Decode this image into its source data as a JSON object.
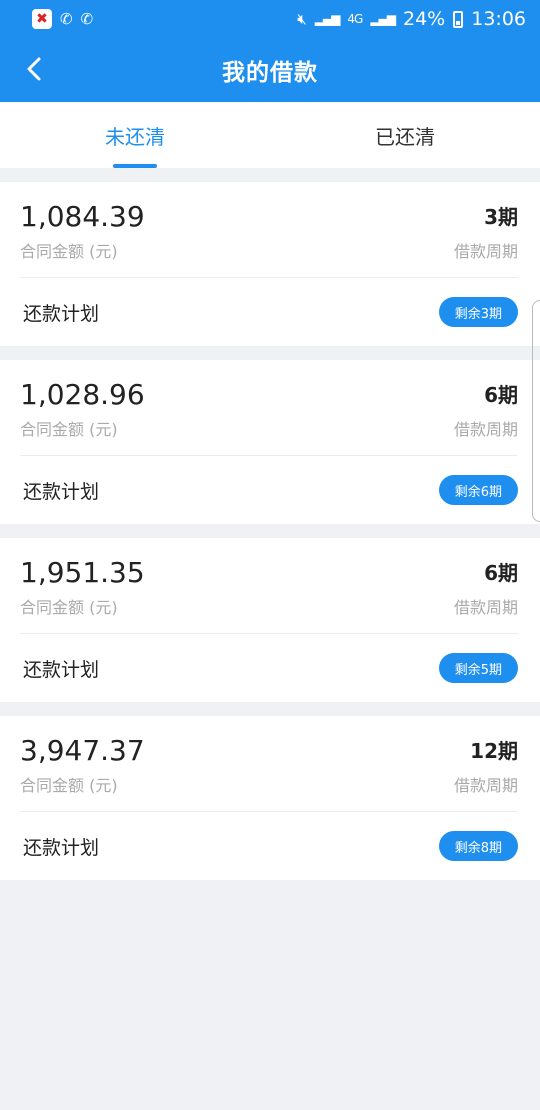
{
  "statusbar": {
    "network": "4G",
    "battery": "24%",
    "time": "13:06"
  },
  "header": {
    "title": "我的借款"
  },
  "tabs": [
    {
      "label": "未还清",
      "active": true
    },
    {
      "label": "已还清",
      "active": false
    }
  ],
  "loans": [
    {
      "amount": "1,084.39",
      "amount_label": "合同金额 (元)",
      "period": "3期",
      "period_label": "借款周期",
      "plan_label": "还款计划",
      "remaining": "剩余3期"
    },
    {
      "amount": "1,028.96",
      "amount_label": "合同金额 (元)",
      "period": "6期",
      "period_label": "借款周期",
      "plan_label": "还款计划",
      "remaining": "剩余6期"
    },
    {
      "amount": "1,951.35",
      "amount_label": "合同金额 (元)",
      "period": "6期",
      "period_label": "借款周期",
      "plan_label": "还款计划",
      "remaining": "剩余5期"
    },
    {
      "amount": "3,947.37",
      "amount_label": "合同金额 (元)",
      "period": "12期",
      "period_label": "借款周期",
      "plan_label": "还款计划",
      "remaining": "剩余8期"
    }
  ],
  "colors": {
    "primary": "#1e8fef",
    "background": "#f0f1f5"
  }
}
